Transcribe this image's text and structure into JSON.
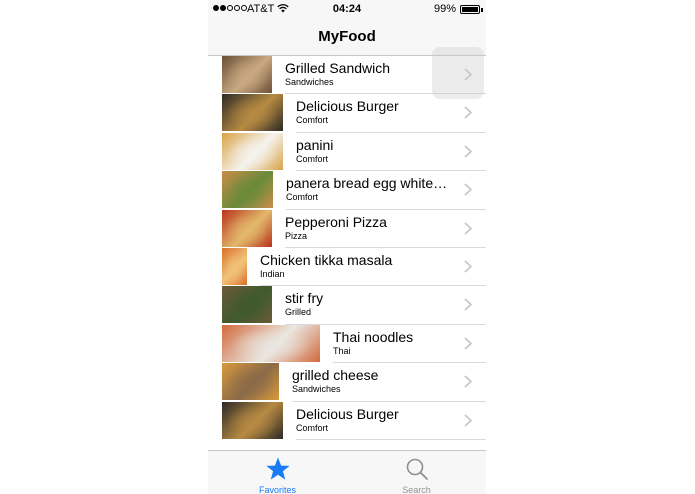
{
  "status_bar": {
    "carrier": "AT&T",
    "time": "04:24",
    "battery": "99%",
    "battery_level": 0.99,
    "signal_bars": 2
  },
  "nav": {
    "title": "MyFood"
  },
  "items": [
    {
      "name": "Grilled Sandwich",
      "category": "Sandwiches",
      "image": "grilled-sandwich",
      "colors": [
        "#6b4f36",
        "#c9a982"
      ]
    },
    {
      "name": "Delicious Burger",
      "category": "Comfort",
      "image": "burger",
      "colors": [
        "#2c2a26",
        "#b78a42"
      ]
    },
    {
      "name": "panini",
      "category": "Comfort",
      "image": "panini",
      "colors": [
        "#d9a347",
        "#f5f3ee"
      ]
    },
    {
      "name": "panera bread egg white…",
      "category": "Comfort",
      "image": "egg-sandwich",
      "colors": [
        "#c98d4a",
        "#6a8a3a"
      ]
    },
    {
      "name": "Pepperoni Pizza",
      "category": "Pizza",
      "image": "pizza",
      "colors": [
        "#b8321e",
        "#e2b86a"
      ]
    },
    {
      "name": "Chicken tikka masala",
      "category": "Indian",
      "image": "tikka-masala",
      "colors": [
        "#d86f2a",
        "#f2c27a"
      ]
    },
    {
      "name": "stir fry",
      "category": "Grilled",
      "image": "stir-fry",
      "colors": [
        "#6b5a3a",
        "#3f5a2c"
      ]
    },
    {
      "name": "Thai noodles",
      "category": "Thai",
      "image": "thai-noodles",
      "colors": [
        "#d26a3c",
        "#eae7e1"
      ]
    },
    {
      "name": "grilled cheese",
      "category": "Sandwiches",
      "image": "grilled-cheese",
      "colors": [
        "#d99a3c",
        "#8a6a48"
      ]
    },
    {
      "name": "Delicious Burger",
      "category": "Comfort",
      "image": "burger",
      "colors": [
        "#2c2a26",
        "#b78a42"
      ]
    }
  ],
  "tabbar": {
    "favorites": {
      "label": "Favorites",
      "icon": "star-icon",
      "color": "#1a7cf5"
    },
    "search": {
      "label": "Search",
      "icon": "search-icon",
      "color": "#929292"
    }
  }
}
